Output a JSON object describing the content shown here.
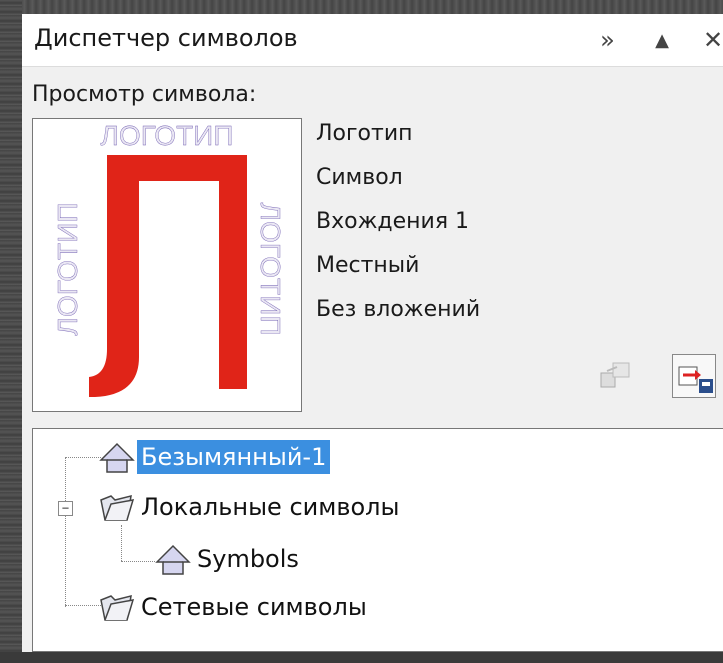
{
  "panel": {
    "title": "Диспетчер символов",
    "expand_label": "»",
    "collapse_label": "▲",
    "close_label": "✕"
  },
  "preview": {
    "label": "Просмотр символа:",
    "logo_letter": "Л",
    "logo_text_top": "ЛОГОТИП",
    "logo_text_left": "ЛОГОТИП",
    "logo_text_right": "ЛОГОТИП",
    "logo_letter_color": "#e02418",
    "logo_text_color": "#6f5cb0"
  },
  "info": {
    "name": "Логотип",
    "type": "Символ",
    "occurrences": "Вхождения 1",
    "scope": "Местный",
    "nesting": "Без вложений"
  },
  "actions": [
    {
      "icon": "insert-symbol-icon",
      "enabled": false
    },
    {
      "icon": "export-library-icon",
      "enabled": true
    }
  ],
  "tree": {
    "items": [
      {
        "label": "Безымянный-1",
        "icon": "symbol-icon",
        "selected": true
      },
      {
        "label": "Локальные символы",
        "icon": "folder-icon",
        "expanded": true
      },
      {
        "label": "Symbols",
        "icon": "symbol-icon"
      },
      {
        "label": "Сетевые символы",
        "icon": "folder-icon"
      }
    ],
    "expander_symbol": "−"
  },
  "colors": {
    "selection": "#3b8fe0",
    "panel_bg": "#f0f0f0"
  }
}
